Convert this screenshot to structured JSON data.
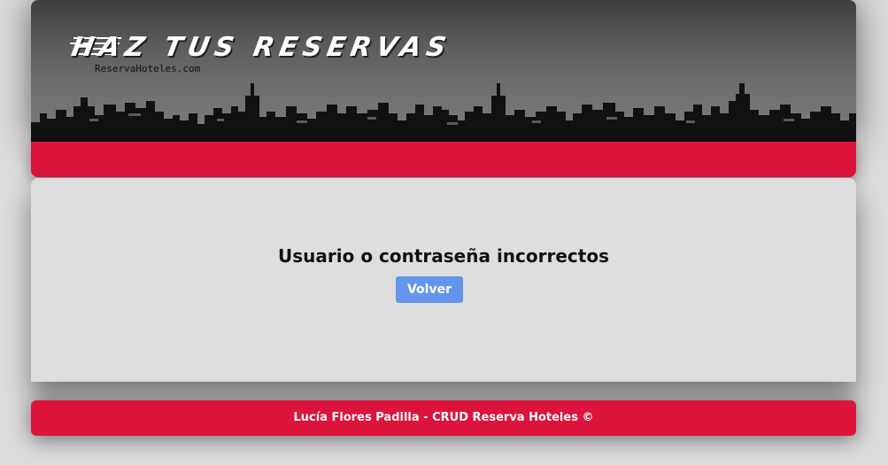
{
  "header": {
    "logo_title": "HAZ TUS RESERVAS",
    "logo_subtitle": "ReservaHoteles.com"
  },
  "main": {
    "message": "Usuario o contraseña incorrectos",
    "back_button_label": "Volver"
  },
  "footer": {
    "text": "Lucía Flores Padilla - CRUD Reserva Hoteles ©"
  },
  "colors": {
    "accent_red": "#dc143c",
    "button_blue": "#6495ed",
    "header_dark": "#4a4a4a",
    "content_bg": "#dedede"
  },
  "icons": [
    "city-skyline-icon",
    "speed-lines-icon"
  ]
}
